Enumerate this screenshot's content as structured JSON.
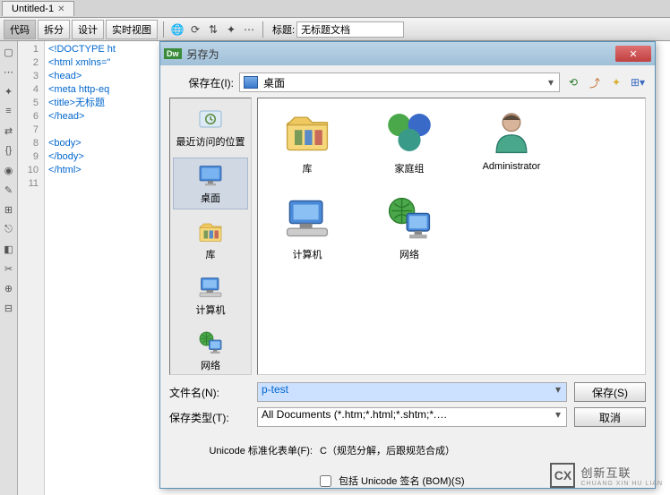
{
  "tab": {
    "name": "Untitled-1"
  },
  "toolbar": {
    "code": "代码",
    "split": "拆分",
    "design": "设计",
    "live": "实时视图",
    "title_label": "标题:",
    "title_value": "无标题文档"
  },
  "gutter": [
    "1",
    "2",
    "3",
    "4",
    "5",
    "6",
    "7",
    "8",
    "9",
    "10",
    "11"
  ],
  "code_lines": [
    "<!DOCTYPE ht",
    "<html xmlns=\"",
    "<head>",
    "<meta http-eq",
    "<title>无标题",
    "</head>",
    "",
    "<body>",
    "</body>",
    "</html>",
    ""
  ],
  "dialog": {
    "app": "Dw",
    "title": "另存为",
    "save_in_label": "保存在(I):",
    "save_in_value": "桌面",
    "places": [
      {
        "label": "最近访问的位置",
        "icon": "recent"
      },
      {
        "label": "桌面",
        "icon": "desktop",
        "selected": true
      },
      {
        "label": "库",
        "icon": "libraries"
      },
      {
        "label": "计算机",
        "icon": "computer"
      },
      {
        "label": "网络",
        "icon": "network"
      }
    ],
    "items": [
      {
        "label": "库",
        "icon": "libraries"
      },
      {
        "label": "家庭组",
        "icon": "homegroup"
      },
      {
        "label": "Administrator",
        "icon": "user"
      },
      {
        "label": "计算机",
        "icon": "computer"
      },
      {
        "label": "网络",
        "icon": "network"
      }
    ],
    "filename_label": "文件名(N):",
    "filename_value": "p-test",
    "filetype_label": "保存类型(T):",
    "filetype_value": "All Documents (*.htm;*.html;*.shtm;*.…",
    "save_btn": "保存(S)",
    "cancel_btn": "取消",
    "unicode_label": "Unicode 标准化表单(F):",
    "unicode_value": "C（规范分解，后跟规范合成）",
    "bom_label": "包括 Unicode 签名 (BOM)(S)"
  },
  "watermark": {
    "logo": "CX",
    "text": "创新互联",
    "sub": "CHUANG XIN HU LIAN"
  }
}
